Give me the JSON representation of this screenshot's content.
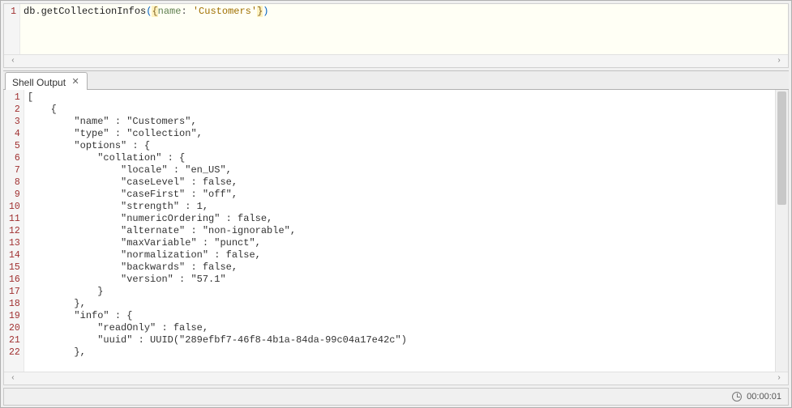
{
  "editor": {
    "lines": [
      {
        "num": "1",
        "tokens": [
          {
            "t": "db",
            "c": "hl-kw"
          },
          {
            "t": ".",
            "c": "hl-punc"
          },
          {
            "t": "getCollectionInfos",
            "c": "hl-func"
          },
          {
            "t": "(",
            "c": "hl-punc-blue"
          },
          {
            "t": "{",
            "c": "hl-brace"
          },
          {
            "t": "name",
            "c": "hl-key"
          },
          {
            "t": ": ",
            "c": "hl-punc"
          },
          {
            "t": "'Customers'",
            "c": "hl-str"
          },
          {
            "t": "}",
            "c": "hl-brace"
          },
          {
            "t": ")",
            "c": "hl-punc-blue"
          }
        ]
      }
    ]
  },
  "tab": {
    "label": "Shell Output"
  },
  "output": {
    "lines": [
      {
        "num": "1",
        "text": "["
      },
      {
        "num": "2",
        "text": "    {"
      },
      {
        "num": "3",
        "text": "        \"name\" : \"Customers\","
      },
      {
        "num": "4",
        "text": "        \"type\" : \"collection\","
      },
      {
        "num": "5",
        "text": "        \"options\" : {"
      },
      {
        "num": "6",
        "text": "            \"collation\" : {"
      },
      {
        "num": "7",
        "text": "                \"locale\" : \"en_US\","
      },
      {
        "num": "8",
        "text": "                \"caseLevel\" : false,"
      },
      {
        "num": "9",
        "text": "                \"caseFirst\" : \"off\","
      },
      {
        "num": "10",
        "text": "                \"strength\" : 1,"
      },
      {
        "num": "11",
        "text": "                \"numericOrdering\" : false,"
      },
      {
        "num": "12",
        "text": "                \"alternate\" : \"non-ignorable\","
      },
      {
        "num": "13",
        "text": "                \"maxVariable\" : \"punct\","
      },
      {
        "num": "14",
        "text": "                \"normalization\" : false,"
      },
      {
        "num": "15",
        "text": "                \"backwards\" : false,"
      },
      {
        "num": "16",
        "text": "                \"version\" : \"57.1\""
      },
      {
        "num": "17",
        "text": "            }"
      },
      {
        "num": "18",
        "text": "        },"
      },
      {
        "num": "19",
        "text": "        \"info\" : {"
      },
      {
        "num": "20",
        "text": "            \"readOnly\" : false,"
      },
      {
        "num": "21",
        "text": "            \"uuid\" : UUID(\"289efbf7-46f8-4b1a-84da-99c04a17e42c\")"
      },
      {
        "num": "22",
        "text": "        },"
      }
    ]
  },
  "status": {
    "elapsed": "00:00:01"
  },
  "scroll": {
    "left_glyph": "‹",
    "right_glyph": "›"
  }
}
